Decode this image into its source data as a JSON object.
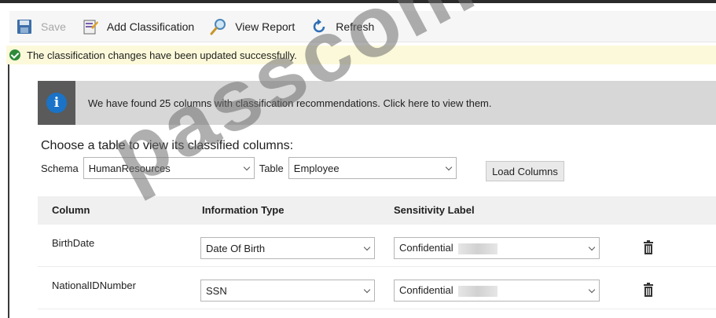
{
  "toolbar": {
    "save_label": "Save",
    "add_classification_label": "Add Classification",
    "view_report_label": "View Report",
    "refresh_label": "Refresh"
  },
  "success_message": "The classification changes have been updated successfully.",
  "info_banner": {
    "text": "We have found 25 columns with classification recommendations. Click here to view them."
  },
  "chooser": {
    "title": "Choose a table to view its classified columns:",
    "schema_label": "Schema",
    "schema_value": "HumanResources",
    "table_label": "Table",
    "table_value": "Employee",
    "load_button_label": "Load Columns"
  },
  "grid": {
    "headers": {
      "column": "Column",
      "information_type": "Information Type",
      "sensitivity_label": "Sensitivity Label"
    },
    "rows": [
      {
        "column": "BirthDate",
        "information_type": "Date Of Birth",
        "sensitivity_label": "Confidential"
      },
      {
        "column": "NationalIDNumber",
        "information_type": "SSN",
        "sensitivity_label": "Confidential"
      }
    ]
  },
  "watermark": "passcom",
  "colors": {
    "success_green": "#2f8a3a",
    "success_bg": "#fbf9d9",
    "info_blue": "#1a73c7",
    "banner_gray": "#d7d7d7"
  }
}
